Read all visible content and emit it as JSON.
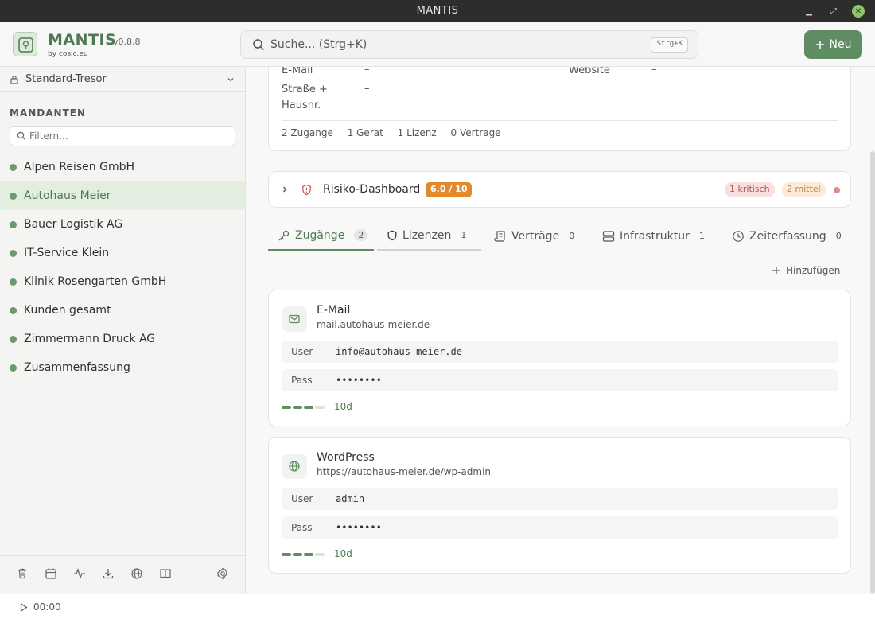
{
  "window": {
    "title": "MANTIS"
  },
  "header": {
    "app_name": "MANTIS",
    "version": "v0.8.8",
    "by": "by cosic.eu",
    "search_placeholder": "Suche... (Strg+K)",
    "search_shortcut": "Strg+K",
    "new_button": "Neu",
    "accent_color": "#5f8c63"
  },
  "sidebar": {
    "vault": "Standard-Tresor",
    "section_title": "MANDANTEN",
    "filter_placeholder": "Filtern...",
    "clients": [
      {
        "label": "Alpen Reisen GmbH"
      },
      {
        "label": "Autohaus Meier",
        "active": true
      },
      {
        "label": "Bauer Logistik AG"
      },
      {
        "label": "IT-Service Klein"
      },
      {
        "label": "Klinik Rosengarten GmbH"
      },
      {
        "label": "Kunden gesamt"
      },
      {
        "label": "Zimmermann Druck AG"
      },
      {
        "label": "Zusammenfassung"
      }
    ],
    "tools": [
      "trash-icon",
      "calendar-icon",
      "activity-icon",
      "download-icon",
      "globe-icon",
      "book-icon",
      "settings-icon"
    ]
  },
  "info": {
    "email_label": "E-Mail",
    "email_value": "–",
    "website_label": "Website",
    "website_value": "–",
    "street_label_1": "Straße +",
    "street_label_2": "Hausnr.",
    "street_value": "–",
    "stats": [
      "2 Zugange",
      "1 Gerat",
      "1 Lizenz",
      "0 Vertrage"
    ]
  },
  "risk": {
    "title": "Risiko-Dashboard",
    "score": "6.0 / 10",
    "critical": "1 kritisch",
    "medium": "2 mittel"
  },
  "tabs": [
    {
      "label": "Zugänge",
      "count": "2"
    },
    {
      "label": "Lizenzen",
      "count": "1"
    },
    {
      "label": "Verträge",
      "count": "0"
    },
    {
      "label": "Infrastruktur",
      "count": "1"
    },
    {
      "label": "Zeiterfassung",
      "count": "0"
    }
  ],
  "add_button": "Hinzufügen",
  "accounts": [
    {
      "icon": "mail-icon",
      "title": "E-Mail",
      "subtitle": "mail.autohaus-meier.de",
      "user_label": "User",
      "user_value": "info@autohaus-meier.de",
      "pass_label": "Pass",
      "pass_value": "••••••••",
      "strength": 0.75,
      "age": "10d"
    },
    {
      "icon": "globe-icon",
      "title": "WordPress",
      "subtitle": "https://autohaus-meier.de/wp-admin",
      "user_label": "User",
      "user_value": "admin",
      "pass_label": "Pass",
      "pass_value": "••••••••",
      "strength": 0.75,
      "age": "10d"
    }
  ],
  "status": {
    "timer": "00:00"
  }
}
